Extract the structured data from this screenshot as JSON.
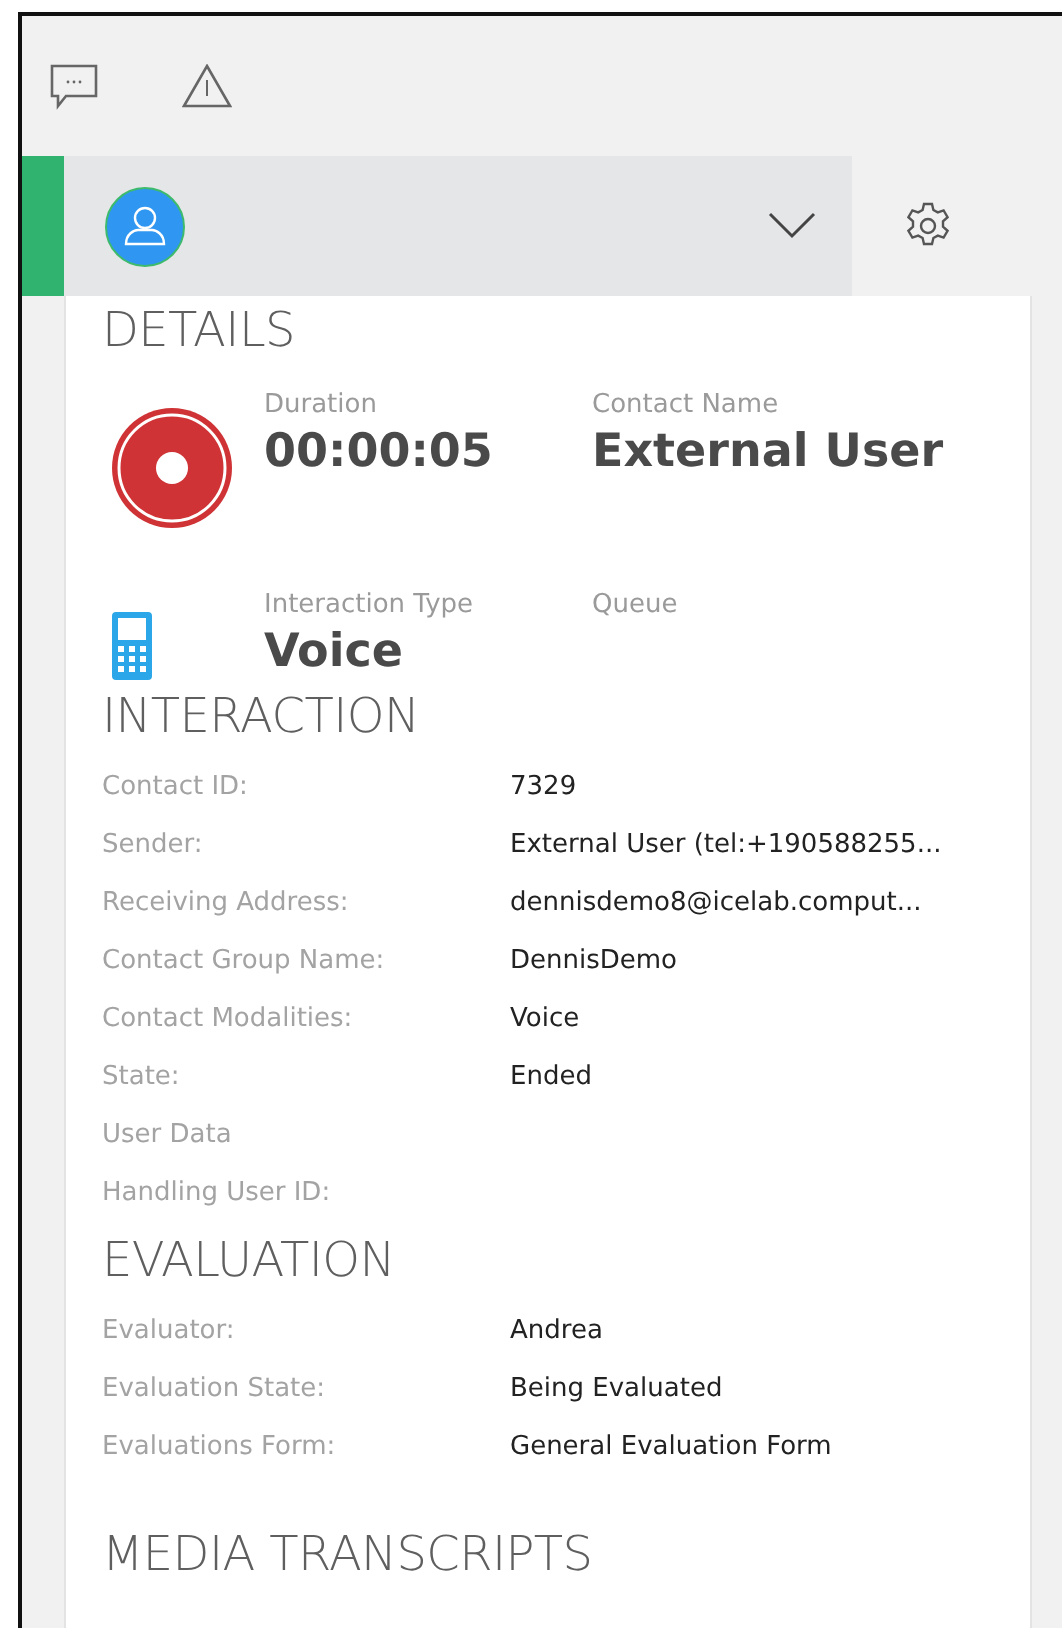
{
  "details": {
    "title": "DETAILS",
    "rows": [
      {
        "kind": "recording",
        "fields": [
          {
            "label": "Duration",
            "value": "00:00:05"
          },
          {
            "label": "Contact Name",
            "value": "External User"
          }
        ]
      },
      {
        "kind": "phone",
        "fields": [
          {
            "label": "Interaction Type",
            "value": "Voice"
          },
          {
            "label": "Queue"
          }
        ]
      }
    ]
  },
  "sections": [
    {
      "title": "INTERACTION",
      "rows": [
        {
          "label": "Contact ID:",
          "value": "7329"
        },
        {
          "label": "Sender:",
          "value": "External User (tel:+190588255..."
        },
        {
          "label": "Receiving Address:",
          "value": "dennisdemo8@icelab.comput..."
        },
        {
          "label": "Contact Group Name:",
          "value": "DennisDemo"
        },
        {
          "label": "Contact Modalities:",
          "value": "Voice"
        },
        {
          "label": "State:",
          "value": "Ended"
        },
        {
          "label": "User Data"
        },
        {
          "label": "Handling User ID:"
        }
      ]
    },
    {
      "title": "EVALUATION",
      "rows": [
        {
          "label": "Evaluator:",
          "value": "Andrea"
        },
        {
          "label": "Evaluation State:",
          "value": "Being Evaluated"
        },
        {
          "label": "Evaluations Form:",
          "value": "General Evaluation Form"
        }
      ]
    },
    {
      "title": "MEDIA TRANSCRIPTS"
    }
  ]
}
